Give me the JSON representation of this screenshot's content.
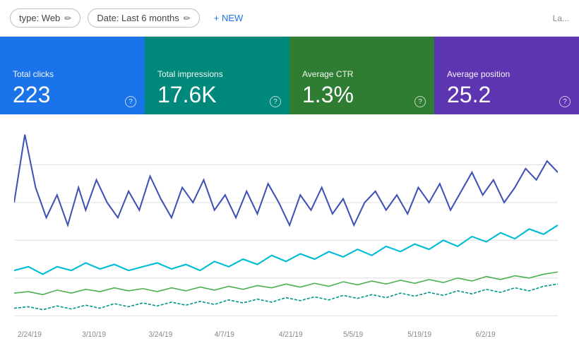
{
  "toolbar": {
    "type_filter_label": "type: Web",
    "date_filter_label": "Date: Last 6 months",
    "new_button_label": "+ NEW",
    "last_label": "La..."
  },
  "stats": [
    {
      "id": "total-clicks",
      "label": "Total clicks",
      "value": "223",
      "color": "blue"
    },
    {
      "id": "total-impressions",
      "label": "Total impressions",
      "value": "17.6K",
      "color": "teal"
    },
    {
      "id": "average-ctr",
      "label": "Average CTR",
      "value": "1.3%",
      "color": "green"
    },
    {
      "id": "average-position",
      "label": "Average position",
      "value": "25.2",
      "color": "purple"
    }
  ],
  "chart": {
    "x_labels": [
      "2/24/19",
      "3/10/19",
      "3/24/19",
      "4/7/19",
      "4/21/19",
      "5/5/19",
      "5/19/19",
      "6/2/19"
    ],
    "colors": {
      "clicks": "#3f51b5",
      "impressions": "#00bcd4",
      "ctr": "#4caf50",
      "position": "#9c27b0"
    }
  }
}
